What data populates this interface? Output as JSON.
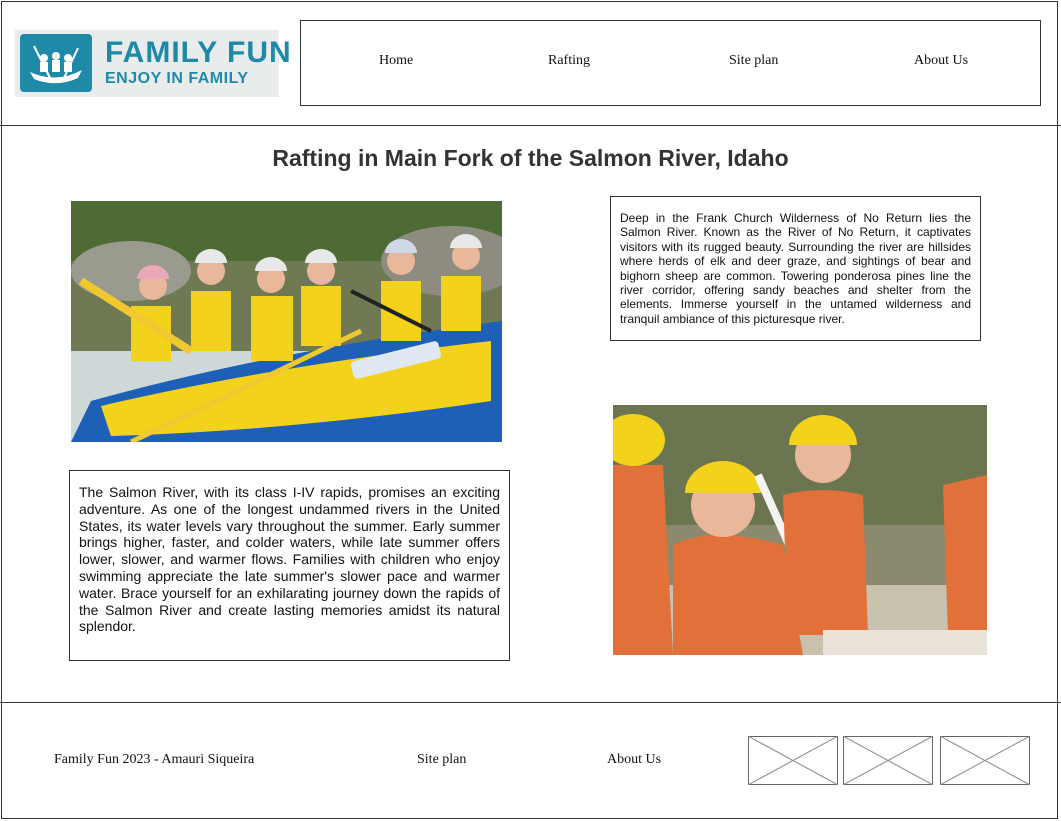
{
  "logo": {
    "title": "FAMILY FUN",
    "tagline": "ENJOY IN FAMILY",
    "colors": {
      "accent": "#1f8aa8",
      "background": "#e9ecec"
    }
  },
  "nav": {
    "items": [
      {
        "label": "Home"
      },
      {
        "label": "Rafting"
      },
      {
        "label": "Site plan"
      },
      {
        "label": "About Us"
      }
    ]
  },
  "main": {
    "title": "Rafting in Main Fork of the Salmon River, Idaho",
    "paragraph_top": "Deep in the Frank Church Wilderness of No Return lies the Salmon River. Known as the River of No Return, it captivates visitors with its rugged beauty. Surrounding the river are hillsides where herds of elk and deer graze, and sightings of bear and bighorn sheep are common. Towering ponderosa pines line the river corridor, offering sandy beaches and shelter from the elements. Immerse yourself in the untamed wilderness and tranquil ambiance of this picturesque river.",
    "paragraph_bottom": "The Salmon River, with its class I-IV rapids, promises an exciting adventure. As one of the longest undammed rivers in the United States, its water levels vary throughout the summer. Early summer brings higher, faster, and colder waters, while late summer offers lower, slower, and warmer flows. Families with children who enjoy swimming appreciate the late summer's slower pace and warmer water. Brace yourself for an exhilarating journey down the rapids of the Salmon River and create lasting memories amidst its natural splendor."
  },
  "footer": {
    "copyright": "Family Fun  2023 - Amauri Siqueira",
    "links": [
      {
        "label": "Site plan"
      },
      {
        "label": "About Us"
      }
    ],
    "social_placeholders": [
      "social-placeholder-1",
      "social-placeholder-2",
      "social-placeholder-3"
    ]
  },
  "colors": {
    "line": "#333333",
    "raft_yellow": "#f2d21a",
    "raft_blue": "#1e5fb8",
    "life_jacket_orange": "#e2703a"
  }
}
